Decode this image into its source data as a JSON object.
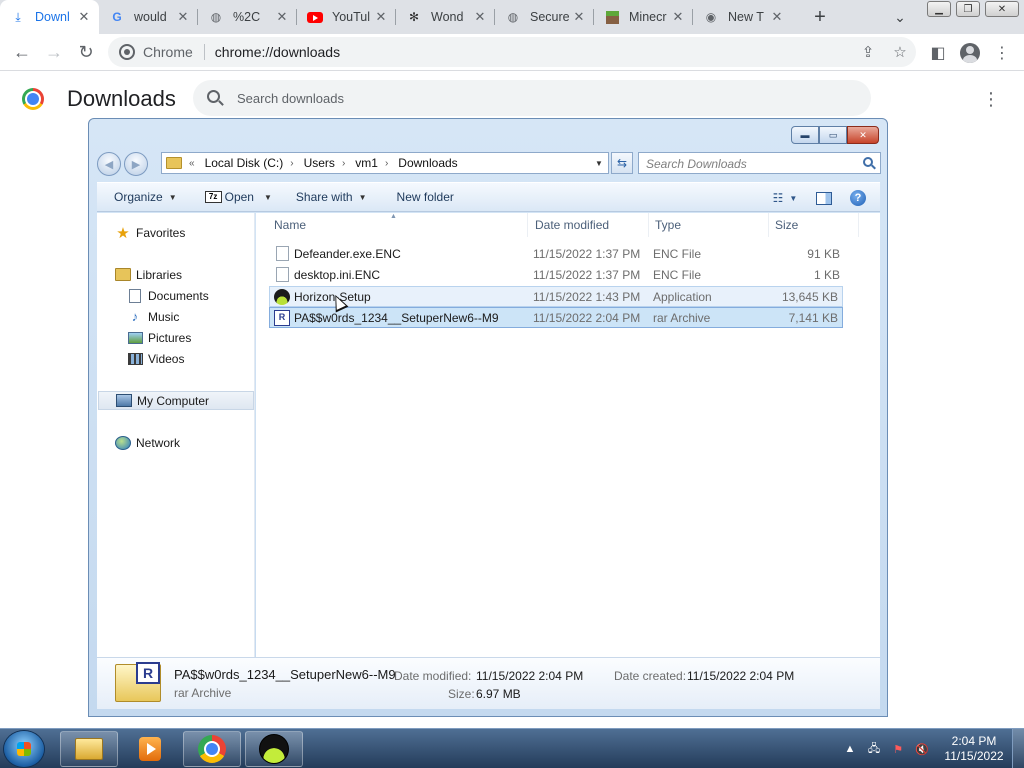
{
  "browser": {
    "tabs": [
      {
        "label": "Downl",
        "icon": "download-icon",
        "active": true
      },
      {
        "label": "would",
        "icon": "google-icon"
      },
      {
        "label": "%2C",
        "icon": "globe-icon"
      },
      {
        "label": "YouTul",
        "icon": "youtube-icon"
      },
      {
        "label": "Wond",
        "icon": "wonder-icon"
      },
      {
        "label": "Secure",
        "icon": "globe-icon"
      },
      {
        "label": "Minecr",
        "icon": "minecraft-icon"
      },
      {
        "label": "New T",
        "icon": "chrome-icon"
      }
    ],
    "omnibox": {
      "chip": "Chrome",
      "url": "chrome://downloads"
    }
  },
  "downloads_page": {
    "title": "Downloads",
    "search_placeholder": "Search downloads"
  },
  "explorer": {
    "breadcrumb": [
      "Local Disk (C:)",
      "Users",
      "vm1",
      "Downloads"
    ],
    "search_placeholder": "Search Downloads",
    "commands": {
      "organize": "Organize",
      "sevenzip_badge": "7z",
      "open": "Open",
      "share": "Share with",
      "new_folder": "New folder"
    },
    "nav": {
      "favorites": "Favorites",
      "libraries": "Libraries",
      "documents": "Documents",
      "music": "Music",
      "pictures": "Pictures",
      "videos": "Videos",
      "computer": "My Computer",
      "network": "Network"
    },
    "columns": {
      "name": "Name",
      "date": "Date modified",
      "type": "Type",
      "size": "Size"
    },
    "files": [
      {
        "name": "Defeander.exe.ENC",
        "date": "11/15/2022 1:37 PM",
        "type": "ENC File",
        "size": "91 KB",
        "icon": "blank-file-icon"
      },
      {
        "name": "desktop.ini.ENC",
        "date": "11/15/2022 1:37 PM",
        "type": "ENC File",
        "size": "1 KB",
        "icon": "blank-file-icon"
      },
      {
        "name": "Horizon-Setup",
        "date": "11/15/2022 1:43 PM",
        "type": "Application",
        "size": "13,645 KB",
        "icon": "horizon-app-icon"
      },
      {
        "name": "PA$$w0rds_1234__SetuperNew6--M9",
        "date": "11/15/2022 2:04 PM",
        "type": "rar Archive",
        "size": "7,141 KB",
        "icon": "rar-archive-icon"
      }
    ],
    "details": {
      "name": "PA$$w0rds_1234__SetuperNew6--M9",
      "type": "rar Archive",
      "modified_label": "Date modified:",
      "modified_value": "11/15/2022 2:04 PM",
      "created_label": "Date created:",
      "created_value": "11/15/2022 2:04 PM",
      "size_label": "Size:",
      "size_value": "6.97 MB"
    }
  },
  "taskbar": {
    "time": "2:04 PM",
    "date": "11/15/2022"
  }
}
